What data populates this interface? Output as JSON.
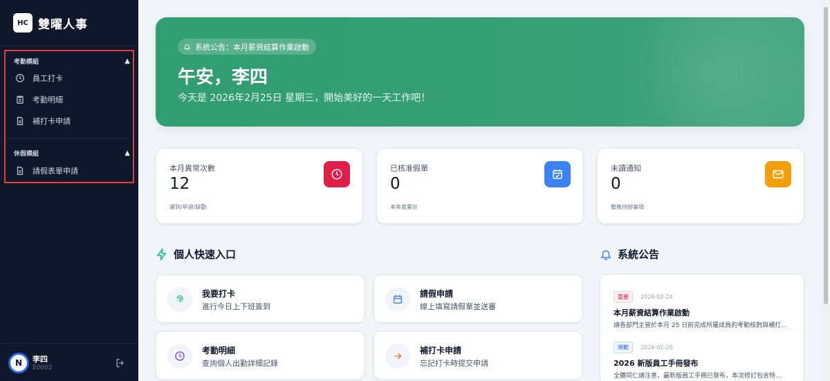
{
  "app": {
    "logo_text": "HC",
    "name": "雙曜人事"
  },
  "sidebar": {
    "groups": [
      {
        "title": "考勤模組",
        "items": [
          {
            "label": "員工打卡"
          },
          {
            "label": "考勤明細"
          },
          {
            "label": "補打卡申請"
          }
        ]
      },
      {
        "title": "休假模組",
        "items": [
          {
            "label": "請假表單申請"
          }
        ]
      }
    ],
    "collapse_glyph": "▲"
  },
  "user": {
    "avatar_letter": "N",
    "name": "李四",
    "id": "E0002"
  },
  "hero": {
    "notice": "系統公告：本月薪資結算作業啟動",
    "greeting": "午安，李四",
    "subtitle": "今天是 2026年2月25日 星期三，開始美好的一天工作吧！"
  },
  "stats": [
    {
      "label": "本月異常次數",
      "value": "12",
      "sub": "遲到/早退/缺勤",
      "icon": "clock-icon",
      "color": "#e11d48"
    },
    {
      "label": "已核准假單",
      "value": "0",
      "sub": "本年度累計",
      "icon": "calendar-check-icon",
      "color": "#3b82f6"
    },
    {
      "label": "未讀通知",
      "value": "0",
      "sub": "暫無待辦事項",
      "icon": "mail-icon",
      "color": "#f59e0b"
    }
  ],
  "quick_section": {
    "title": "個人快速入口"
  },
  "quick_links": [
    {
      "title": "我要打卡",
      "sub": "進行今日上下班簽到",
      "icon": "fingerprint-icon"
    },
    {
      "title": "請假申請",
      "sub": "線上填寫請假單並送審",
      "icon": "calendar-icon"
    },
    {
      "title": "考勤明細",
      "sub": "查詢個人出勤詳細記錄",
      "icon": "clock-icon"
    },
    {
      "title": "補打卡申請",
      "sub": "忘記打卡時提交申請",
      "icon": "arrow-right-icon"
    }
  ],
  "announcements_section": {
    "title": "系統公告"
  },
  "announcements": [
    {
      "tag": "重要",
      "date": "2026-02-24",
      "title": "本月薪資結算作業啟動",
      "body": "請各部門主管於本月 25 日前完成所屬成員的考勤核對與補打..."
    },
    {
      "tag": "規範",
      "date": "2026-02-20",
      "title": "2026 新版員工手冊發布",
      "body": "全體同仁請注意，最新版員工手冊已發布，本次修訂包含特..."
    }
  ]
}
